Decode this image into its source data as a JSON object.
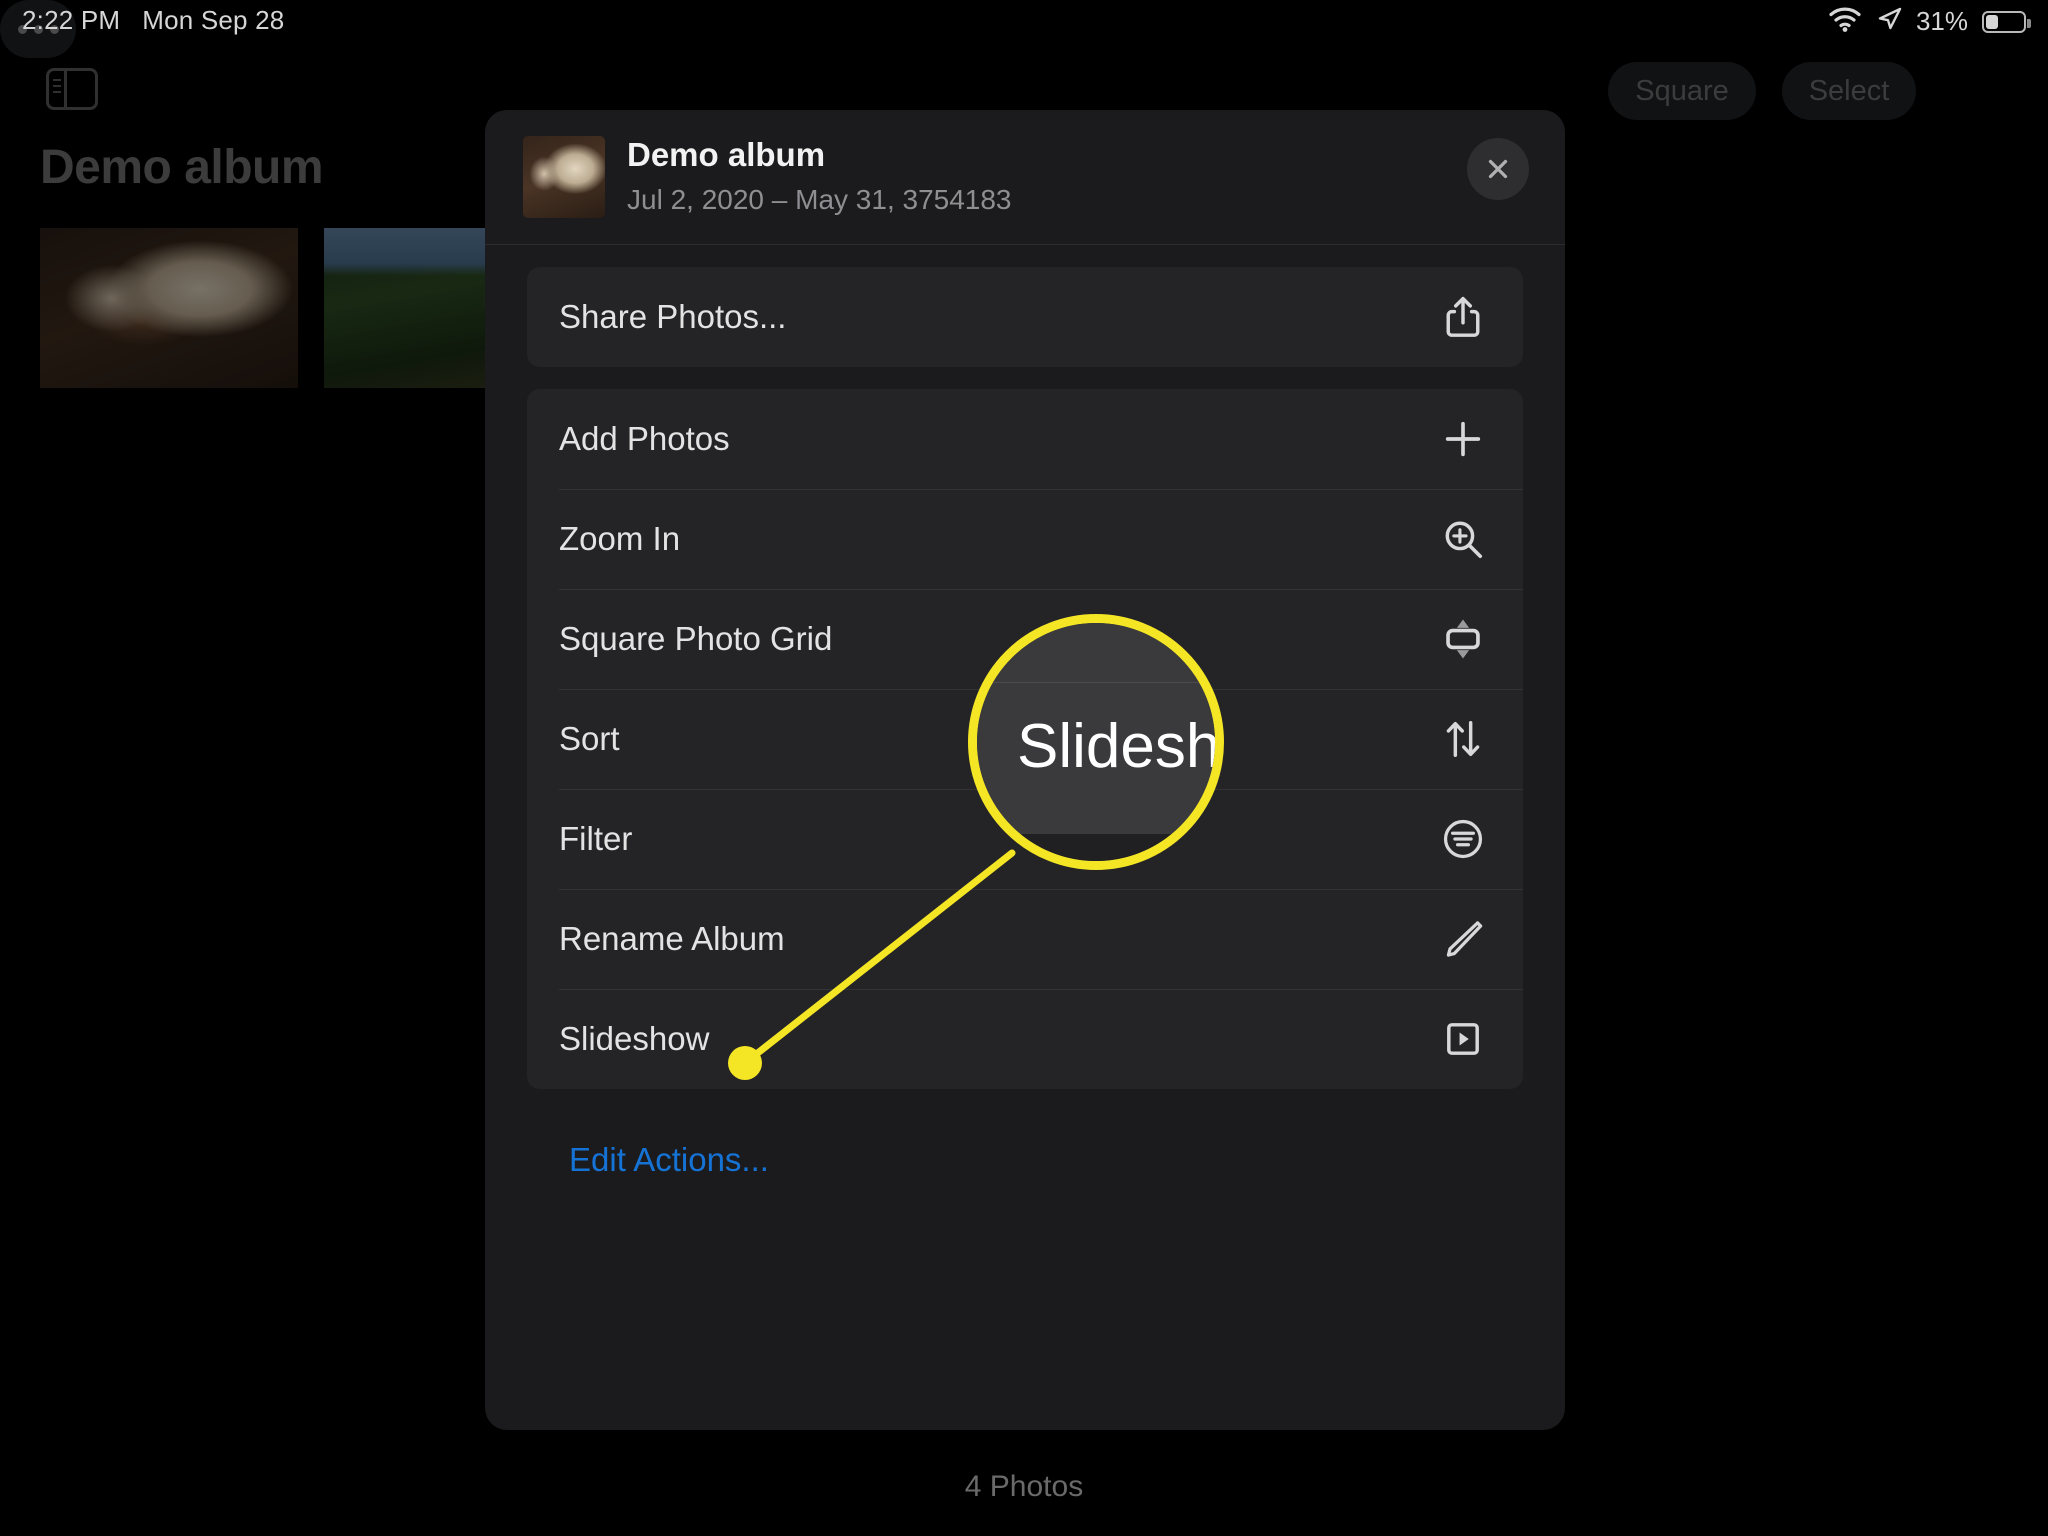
{
  "status_bar": {
    "time": "2:22 PM",
    "date": "Mon Sep 28",
    "battery_percent": "31%",
    "wifi_icon": "wifi-icon",
    "location_icon": "location-arrow-icon",
    "battery_icon": "battery-icon",
    "battery_level": 31
  },
  "background": {
    "sidebar_toggle_icon": "sidebar-toggle-icon",
    "album_title": "Demo album",
    "toolbar": {
      "square_label": "Square",
      "select_label": "Select",
      "more_icon": "ellipsis-icon"
    },
    "photos": [
      {
        "name": "sleeping-dog-photo"
      },
      {
        "name": "house-in-trees-photo"
      }
    ],
    "photo_count": "4 Photos"
  },
  "dialog": {
    "thumbnail": "album-cover-thumbnail",
    "title": "Demo album",
    "subtitle": "Jul 2, 2020 – May 31, 3754183",
    "close_icon": "close-icon",
    "groups": [
      {
        "name": "share-group",
        "items": [
          {
            "label": "Share Photos...",
            "icon": "share-icon",
            "key": "share-photos"
          }
        ]
      },
      {
        "name": "actions-group",
        "items": [
          {
            "label": "Add Photos",
            "icon": "plus-icon",
            "key": "add-photos"
          },
          {
            "label": "Zoom In",
            "icon": "zoom-in-icon",
            "key": "zoom-in"
          },
          {
            "label": "Square Photo Grid",
            "icon": "square-photo-grid-icon",
            "key": "square-photo-grid"
          },
          {
            "label": "Sort",
            "icon": "sort-arrows-icon",
            "key": "sort"
          },
          {
            "label": "Filter",
            "icon": "filter-icon",
            "key": "filter"
          },
          {
            "label": "Rename Album",
            "icon": "pencil-icon",
            "key": "rename-album"
          },
          {
            "label": "Slideshow",
            "icon": "play-box-icon",
            "key": "slideshow"
          }
        ]
      }
    ],
    "edit_actions_label": "Edit Actions..."
  },
  "callout": {
    "magnified_label": "Slideshow",
    "highlight_color": "#F5E625",
    "target": "slideshow-menu-item"
  },
  "colors": {
    "accent_blue": "#1673D6",
    "dialog_bg": "#1B1B1D",
    "group_bg": "#242426",
    "highlight_yellow": "#F5E625"
  }
}
